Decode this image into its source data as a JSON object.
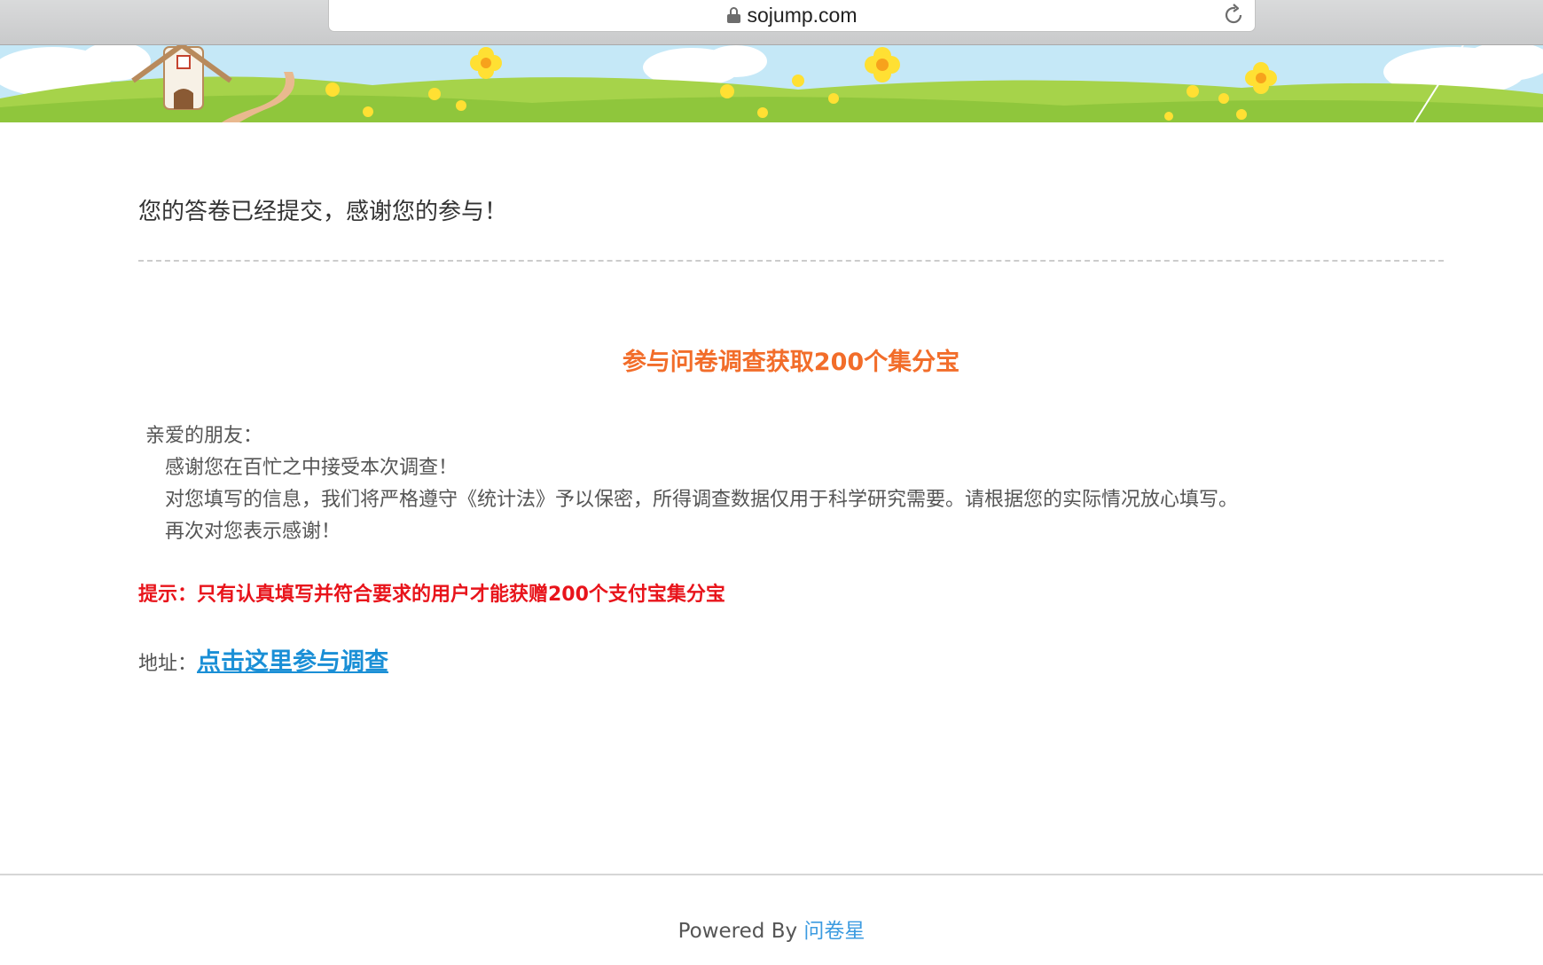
{
  "browser": {
    "url": "sojump.com",
    "icons": {
      "lock": "lock-icon",
      "reload": "reload-icon"
    }
  },
  "banner": {
    "description_icons": [
      "windmill-icon",
      "flower-icon",
      "cloud-icon"
    ]
  },
  "main": {
    "submitted_message": "您的答卷已经提交，感谢您的参与！",
    "promo_title": "参与问卷调查获取200个集分宝",
    "greeting": "亲爱的朋友：",
    "letter_lines": [
      "感谢您在百忙之中接受本次调查！",
      "对您填写的信息，我们将严格遵守《统计法》予以保密，所得调查数据仅用于科学研究需要。请根据您的实际情况放心填写。",
      "再次对您表示感谢！"
    ],
    "hint": "提示：只有认真填写并符合要求的用户才能获赠200个支付宝集分宝",
    "address_label": "地址：",
    "address_link": "点击这里参与调查"
  },
  "footer": {
    "powered_by": "Powered By ",
    "brand": "问卷星"
  },
  "colors": {
    "promo": "#f26d2a",
    "hint": "#e8141b",
    "link": "#1a8fd6",
    "footer_link": "#3c9be0"
  }
}
